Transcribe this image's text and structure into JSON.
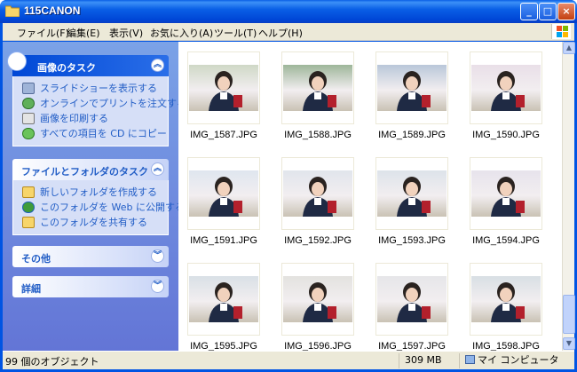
{
  "window": {
    "title": "115CANON"
  },
  "menu": [
    "ファイル(F)",
    "編集(E)",
    "表示(V)",
    "お気に入り(A)",
    "ツール(T)",
    "ヘルプ(H)"
  ],
  "sidebar": {
    "picture_tasks": {
      "title": "画像のタスク",
      "items": [
        {
          "label": "スライドショーを表示する",
          "icon": "slideshow-icon"
        },
        {
          "label": "オンラインでプリントを注文する",
          "icon": "online-print-icon"
        },
        {
          "label": "画像を印刷する",
          "icon": "printer-icon"
        },
        {
          "label": "すべての項目を CD にコピー",
          "icon": "cd-copy-icon"
        }
      ]
    },
    "file_tasks": {
      "title": "ファイルとフォルダのタスク",
      "items": [
        {
          "label": "新しいフォルダを作成する",
          "icon": "new-folder-icon"
        },
        {
          "label": "このフォルダを Web に公開する",
          "icon": "web-publish-icon"
        },
        {
          "label": "このフォルダを共有する",
          "icon": "share-folder-icon"
        }
      ]
    },
    "other": {
      "title": "その他"
    },
    "details": {
      "title": "詳細"
    }
  },
  "files": [
    "IMG_1587.JPG",
    "IMG_1588.JPG",
    "IMG_1589.JPG",
    "IMG_1590.JPG",
    "IMG_1591.JPG",
    "IMG_1592.JPG",
    "IMG_1593.JPG",
    "IMG_1594.JPG",
    "IMG_1595.JPG",
    "IMG_1596.JPG",
    "IMG_1597.JPG",
    "IMG_1598.JPG"
  ],
  "status": {
    "objects": "99 個のオブジェクト",
    "size": "309 MB",
    "location": "マイ コンピュータ"
  },
  "colors": {
    "title_bar": "#0054e3",
    "task_link": "#215dc6",
    "sidebar": "#6375d6"
  }
}
